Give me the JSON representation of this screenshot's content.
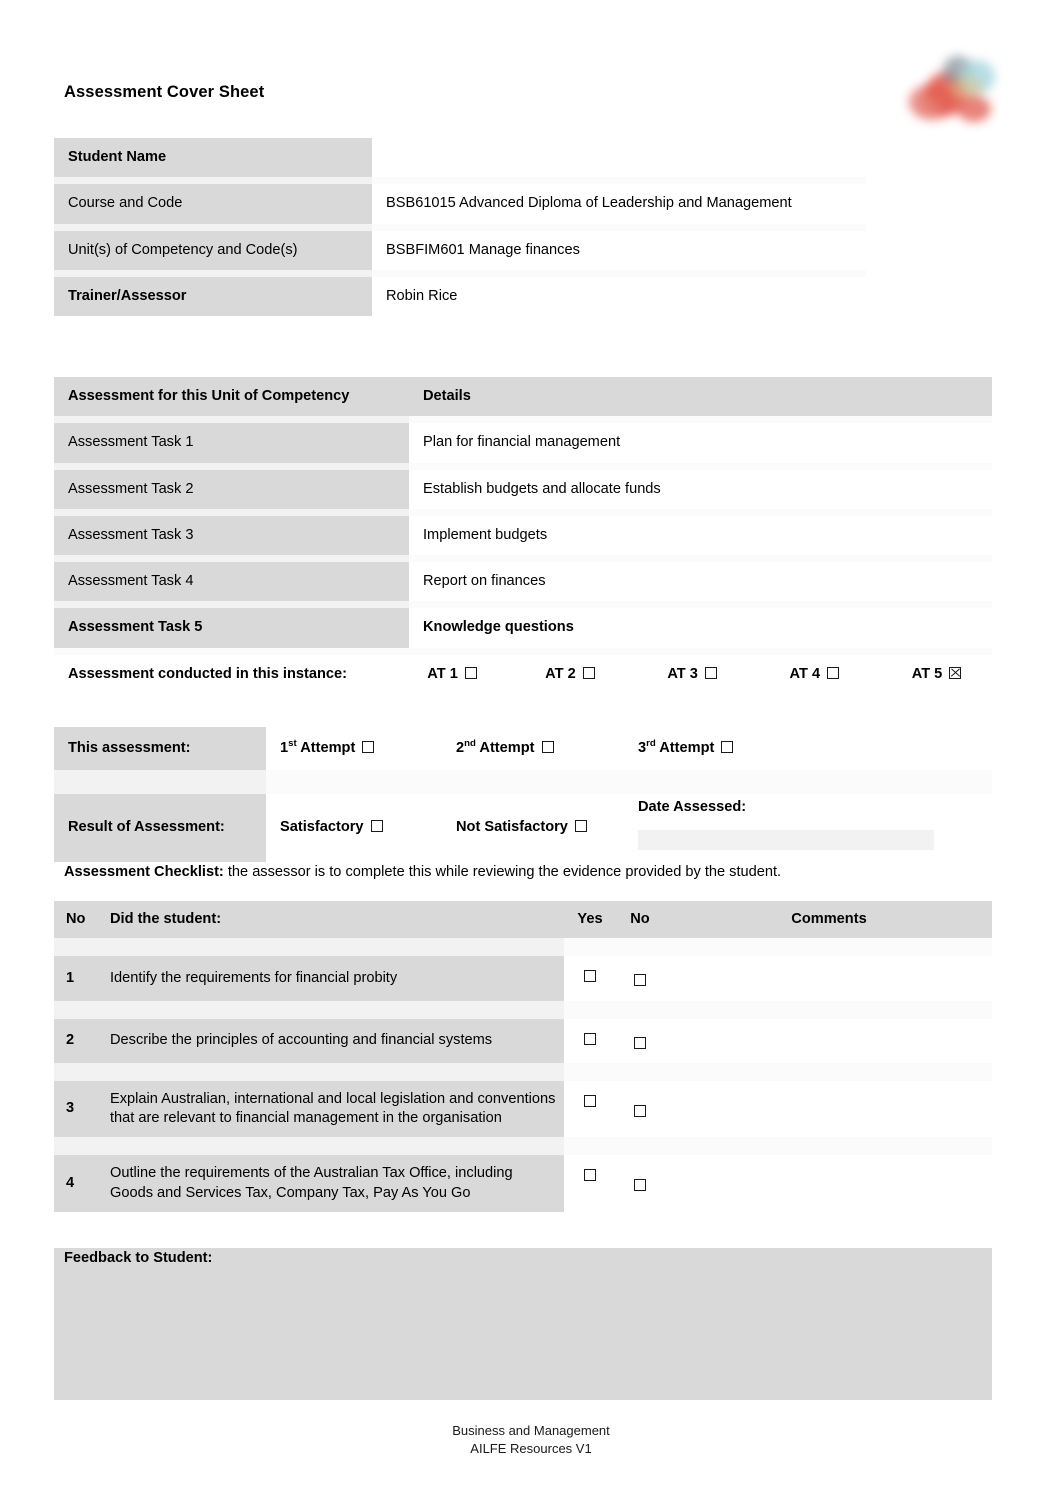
{
  "document": {
    "title": "Assessment Cover Sheet",
    "logo_icon": "organisation-logo"
  },
  "student_details": {
    "rows": [
      {
        "label": "Student Name",
        "value": "",
        "bold": true
      },
      {
        "label": "Course and Code",
        "value": "BSB61015 Advanced Diploma of Leadership and Management",
        "bold": false
      },
      {
        "label": "Unit(s) of Competency and Code(s)",
        "value": "BSBFIM601 Manage finances",
        "bold": false
      },
      {
        "label": "Trainer/Assessor",
        "value": "Robin Rice",
        "bold": true
      }
    ]
  },
  "assessment_tasks": {
    "header": {
      "col1": "Assessment for this Unit of Competency",
      "col2": "Details"
    },
    "rows": [
      {
        "task": "Assessment Task 1",
        "detail": "Plan for financial management"
      },
      {
        "task": "Assessment Task 2",
        "detail": "Establish budgets and allocate funds"
      },
      {
        "task": "Assessment Task 3",
        "detail": "Implement budgets"
      },
      {
        "task": "Assessment Task 4",
        "detail": "Report on finances"
      },
      {
        "task": "Assessment Task 5",
        "detail": "Knowledge questions"
      }
    ],
    "conducted_label": "Assessment conducted in this instance:",
    "conducted_options": [
      {
        "label": "AT 1",
        "checked": false
      },
      {
        "label": "AT 2",
        "checked": false
      },
      {
        "label": "AT 3",
        "checked": false
      },
      {
        "label": "AT 4",
        "checked": false
      },
      {
        "label": "AT 5",
        "checked": true
      }
    ]
  },
  "assessment_result": {
    "this_assessment_label": "This assessment:",
    "attempts": [
      {
        "ordinal": "1",
        "suffix": "st",
        "label": "Attempt",
        "checked": false
      },
      {
        "ordinal": "2",
        "suffix": "nd",
        "label": "Attempt",
        "checked": false
      },
      {
        "ordinal": "3",
        "suffix": "rd",
        "label": "Attempt",
        "checked": false
      }
    ],
    "result_label": "Result of Assessment:",
    "results": [
      {
        "label": "Satisfactory",
        "checked": false
      },
      {
        "label": "Not Satisfactory",
        "checked": false
      }
    ],
    "date_assessed_label": "Date Assessed:",
    "date_assessed_value": ""
  },
  "checklist": {
    "intro_bold": "Assessment Checklist:",
    "intro_rest": " the assessor is to complete this while reviewing the evidence provided by the student.",
    "headers": {
      "no": "No",
      "question": "Did the student:",
      "yes": "Yes",
      "no_col": "No",
      "comments": "Comments"
    },
    "rows": [
      {
        "no": "1",
        "question": "Identify the requirements for financial probity",
        "yes_checked": false,
        "no_checked": false,
        "comment": ""
      },
      {
        "no": "2",
        "question": "Describe the principles of accounting and financial systems",
        "yes_checked": false,
        "no_checked": false,
        "comment": ""
      },
      {
        "no": "3",
        "question": "Explain Australian, international and local legislation and conventions that are relevant to financial management in the organisation",
        "yes_checked": false,
        "no_checked": false,
        "comment": ""
      },
      {
        "no": "4",
        "question": "Outline the requirements of the Australian Tax Office, including Goods and Services Tax, Company Tax, Pay As You Go",
        "yes_checked": false,
        "no_checked": false,
        "comment": ""
      }
    ]
  },
  "feedback": {
    "label": "Feedback to Student:",
    "value": ""
  },
  "footer": {
    "line1": "Business and Management",
    "line2": "AILFE Resources V1"
  },
  "colors": {
    "shade": "#d9d9d9",
    "gap": "#f2f2f2",
    "text": "#000000"
  }
}
